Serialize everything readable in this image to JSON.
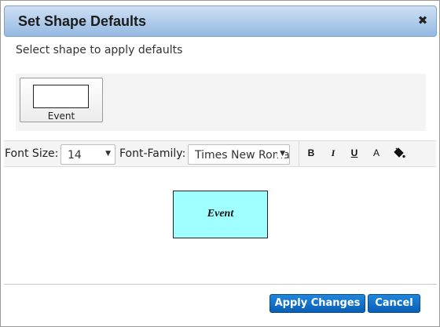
{
  "dialog": {
    "title": "Set Shape Defaults",
    "close_symbol": "✖"
  },
  "prompt": "Select shape to apply defaults",
  "shapes": [
    {
      "label": "Event",
      "selected": true
    }
  ],
  "toolbar": {
    "font_size_label": "Font Size:",
    "font_size_value": "14",
    "font_family_label": "Font-Family:",
    "font_family_value": "Times New Roman",
    "bold_label": "B",
    "italic_label": "I",
    "underline_label": "U",
    "font_color_label": "A",
    "icons": [
      "bold-icon",
      "italic-icon",
      "underline-icon",
      "font-color-icon",
      "fill-color-icon"
    ]
  },
  "preview": {
    "text": "Event",
    "fill_color": "#a0ffff"
  },
  "buttons": {
    "apply": "Apply Changes",
    "cancel": "Cancel"
  },
  "colors": {
    "titlebar": "#94b9e2",
    "primary_button": "#0a5fb5"
  }
}
